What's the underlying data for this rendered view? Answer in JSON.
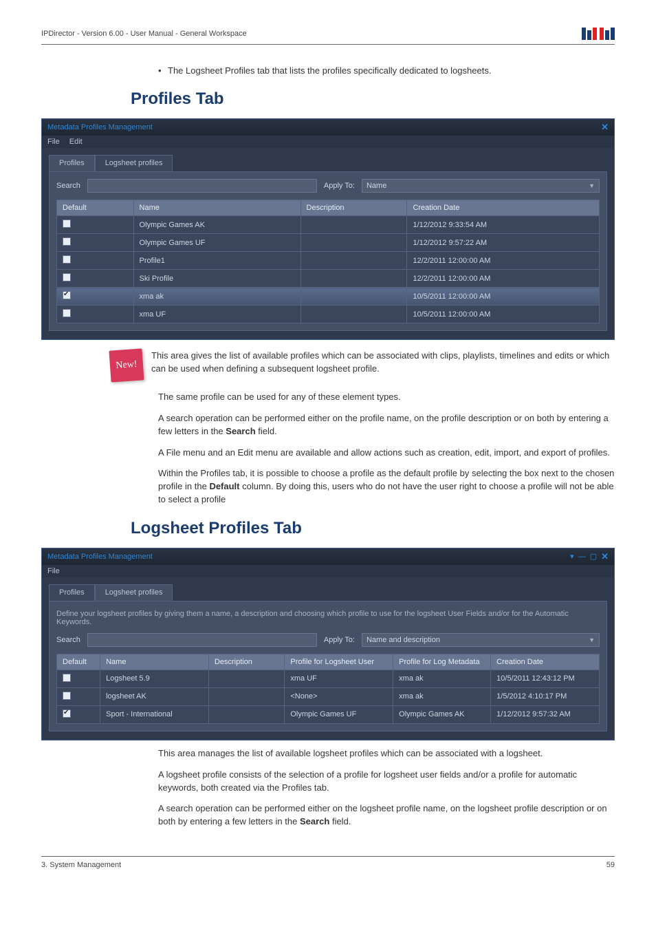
{
  "header": {
    "breadcrumb": "IPDirector - Version 6.00 - User Manual - General Workspace"
  },
  "bullet": "The Logsheet Profiles tab that lists the profiles specifically dedicated to logsheets.",
  "section1": {
    "title": "Profiles Tab"
  },
  "window1": {
    "title": "Metadata Profiles Management",
    "menu": [
      "File",
      "Edit"
    ],
    "tabs": [
      "Profiles",
      "Logsheet profiles"
    ],
    "activeTab": 0,
    "search_label": "Search",
    "apply_label": "Apply To:",
    "apply_value": "Name",
    "columns": [
      "Default",
      "Name",
      "Description",
      "Creation Date"
    ],
    "rows": [
      {
        "checked": false,
        "name": "Olympic Games AK",
        "desc": "",
        "date": "1/12/2012 9:33:54 AM"
      },
      {
        "checked": false,
        "name": "Olympic Games UF",
        "desc": "",
        "date": "1/12/2012 9:57:22 AM"
      },
      {
        "checked": false,
        "name": "Profile1",
        "desc": "",
        "date": "12/2/2011 12:00:00 AM"
      },
      {
        "checked": false,
        "name": "Ski Profile",
        "desc": "",
        "date": "12/2/2011 12:00:00 AM"
      },
      {
        "checked": true,
        "name": "xma ak",
        "desc": "",
        "date": "10/5/2011 12:00:00 AM",
        "selected": true
      },
      {
        "checked": false,
        "name": "xma UF",
        "desc": "",
        "date": "10/5/2011 12:00:00 AM"
      }
    ]
  },
  "new_badge": "New!",
  "note1_a": "This area gives the list of available profiles which can be associated with clips, playlists, timelines and edits or which can be used when defining a subsequent logsheet profile.",
  "para1": "The same profile can be used for any of these element types.",
  "para2a": "A search operation can be performed either on the profile name, on the profile description or on both by entering a few letters in the ",
  "para2b": "Search",
  "para2c": " field.",
  "para3": "A File menu and an Edit menu are available and allow actions such as creation, edit, import, and export of profiles.",
  "para4a": "Within the Profiles tab, it is possible to choose a profile as the default profile by selecting the box next to the chosen profile in the ",
  "para4b": "Default",
  "para4c": " column. By doing this, users who do not have the user right to choose a profile will not be able to select a profile",
  "section2": {
    "title": "Logsheet Profiles Tab"
  },
  "window2": {
    "title": "Metadata Profiles Management",
    "menu": [
      "File"
    ],
    "tabs": [
      "Profiles",
      "Logsheet profiles"
    ],
    "activeTab": 1,
    "hint": "Define your logsheet profiles by giving them a name, a description and choosing which profile to use for the logsheet User Fields and/or for the Automatic Keywords.",
    "search_label": "Search",
    "apply_label": "Apply To:",
    "apply_value": "Name and description",
    "columns": [
      "Default",
      "Name",
      "Description",
      "Profile for Logsheet User",
      "Profile for Log Metadata",
      "Creation Date"
    ],
    "rows": [
      {
        "checked": false,
        "name": "Logsheet 5.9",
        "desc": "",
        "puser": "xma UF",
        "pmeta": "xma ak",
        "date": "10/5/2011 12:43:12 PM"
      },
      {
        "checked": false,
        "name": "logsheet AK",
        "desc": "",
        "puser": "<None>",
        "pmeta": "xma ak",
        "date": "1/5/2012 4:10:17 PM"
      },
      {
        "checked": true,
        "name": "Sport - International",
        "desc": "",
        "puser": "Olympic Games UF",
        "pmeta": "Olympic Games AK",
        "date": "1/12/2012 9:57:32 AM"
      }
    ]
  },
  "para5": "This area manages the list of available logsheet profiles which can be associated with a logsheet.",
  "para6": "A logsheet profile consists of the selection of a profile for logsheet user fields and/or a profile for automatic keywords, both created via the Profiles tab.",
  "para7a": "A search operation can be performed either on the logsheet profile name, on the logsheet profile description or on both by entering a few letters in the ",
  "para7b": "Search",
  "para7c": " field.",
  "footer": {
    "left": "3. System Management",
    "right": "59"
  }
}
